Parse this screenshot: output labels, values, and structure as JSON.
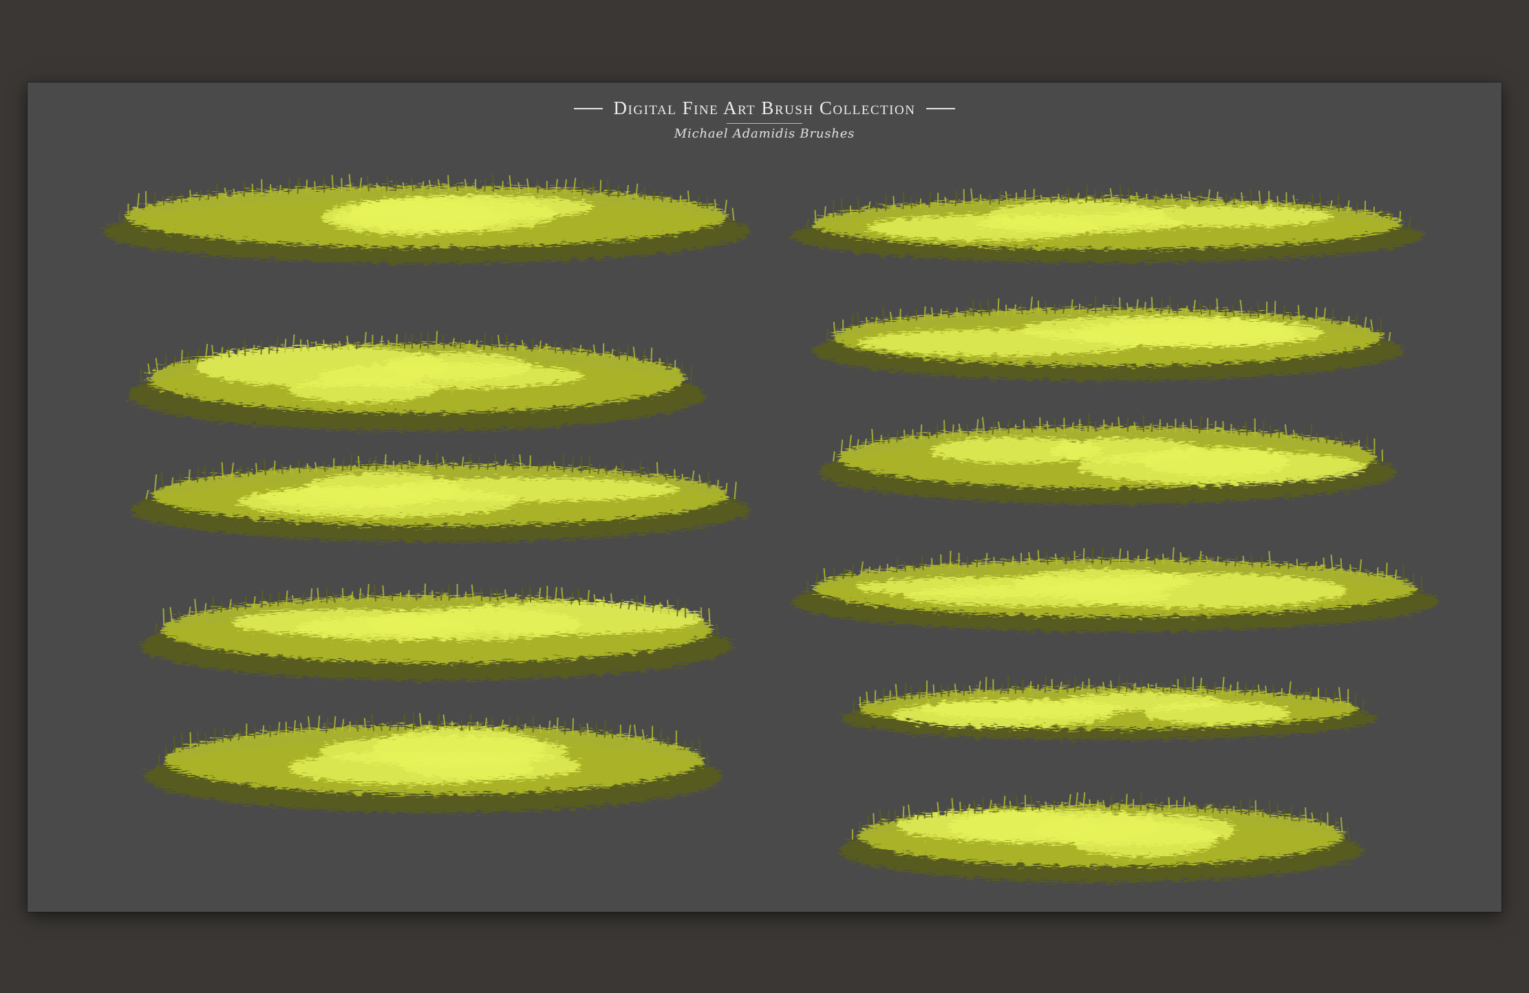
{
  "header": {
    "title": "Digital Fine Art Brush Collection",
    "subtitle": "Michael Adamidis Brushes"
  },
  "colors": {
    "outer_background": "#3a3734",
    "canvas_background": "#4a4a4b",
    "brush_highlight": "#e6f25a",
    "brush_mid": "#b8c22a",
    "brush_shadow": "#5b6216"
  }
}
